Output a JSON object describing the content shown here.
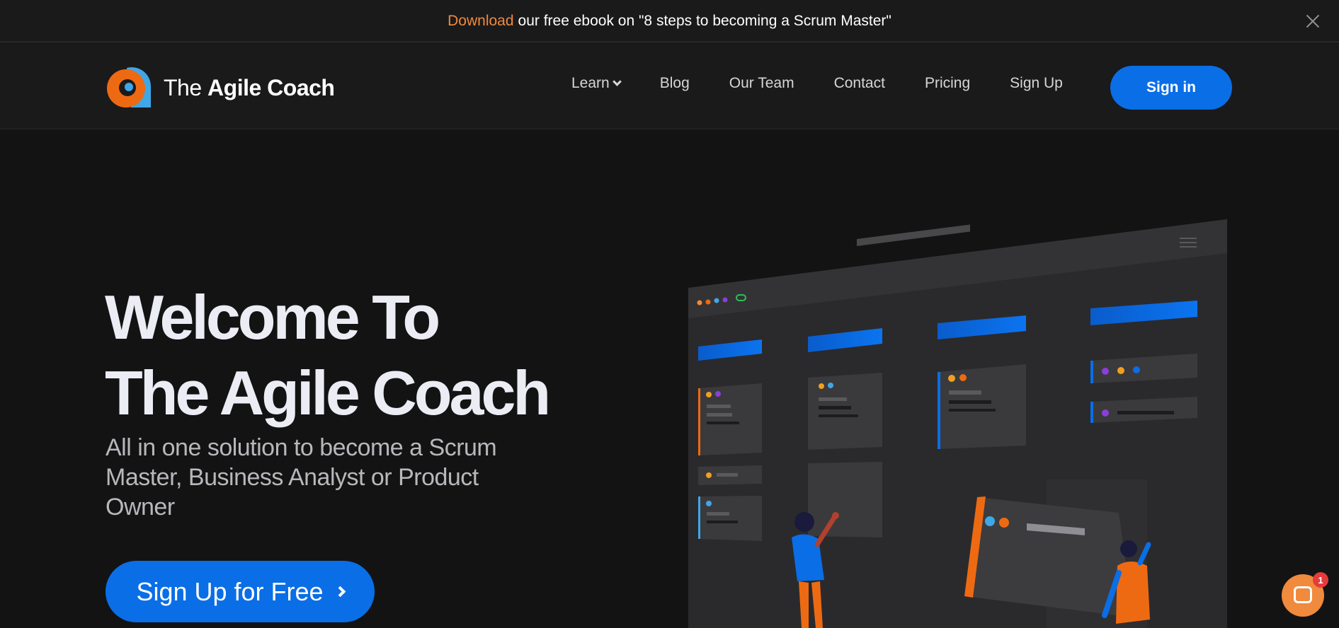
{
  "banner": {
    "link_text": "Download",
    "text": "our free ebook on \"8 steps to becoming a Scrum Master\""
  },
  "nav": {
    "brand_prefix": "The",
    "brand_bold": "Agile Coach",
    "items": [
      {
        "label": "Learn",
        "has_dropdown": true
      },
      {
        "label": "Blog"
      },
      {
        "label": "Our Team"
      },
      {
        "label": "Contact"
      },
      {
        "label": "Pricing"
      },
      {
        "label": "Sign Up"
      }
    ],
    "signin_label": "Sign in"
  },
  "hero": {
    "title_line1": "Welcome To",
    "title_line2": "The Agile Coach",
    "subtitle": "All in one solution to become a Scrum Master, Business Analyst or Product Owner",
    "cta_label": "Sign Up for Free"
  },
  "chat": {
    "badge": "1"
  },
  "colors": {
    "accent_blue": "#0a6ee6",
    "accent_orange": "#f08a3c",
    "background": "#131314"
  }
}
